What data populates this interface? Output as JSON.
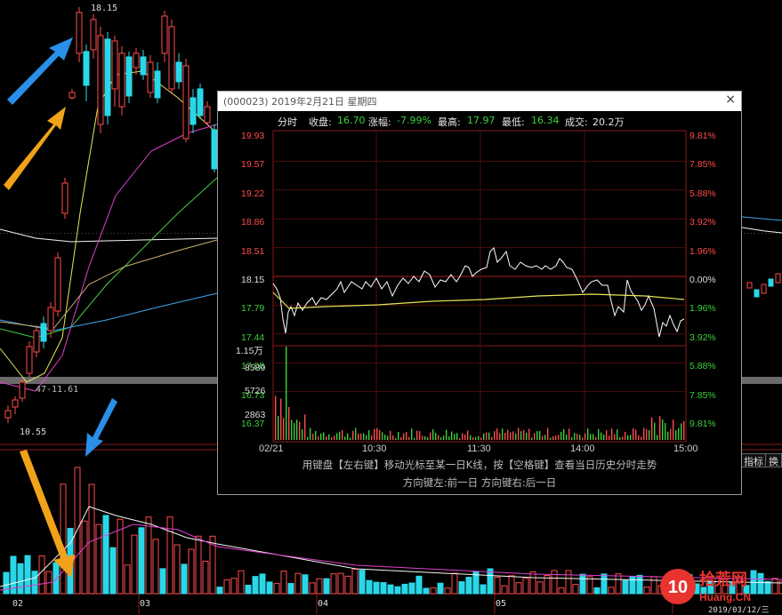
{
  "background_chart": {
    "high_label": "18.15",
    "low_label": "10.55",
    "ma_label": "47-11.61",
    "month_labels": [
      "02",
      "03",
      "04",
      "05"
    ],
    "date_tail": "2019/03/12/三",
    "side_buttons": [
      "指标",
      "换"
    ]
  },
  "popup": {
    "title": "(000023) 2019年2月21日 星期四",
    "close_glyph": "×",
    "info": {
      "label": "分时",
      "close_label": "收盘:",
      "close_value": "16.70",
      "change_label": "涨幅:",
      "change_value": "-7.99%",
      "high_label": "最高:",
      "high_value": "17.97",
      "low_label": "最低:",
      "low_value": "16.34",
      "volume_label": "成交:",
      "volume_value": "20.2万"
    },
    "price_labels": [
      "19.93",
      "19.57",
      "19.22",
      "18.86",
      "18.51",
      "18.15",
      "17.79",
      "17.44",
      "17.08",
      "16.73",
      "16.37"
    ],
    "pct_labels": [
      "9.81%",
      "7.85%",
      "5.88%",
      "3.92%",
      "1.96%",
      "0.00%",
      "1.96%",
      "3.92%",
      "5.88%",
      "7.85%",
      "9.81%"
    ],
    "volume_labels": [
      "1.15万",
      "8589",
      "5726",
      "2863"
    ],
    "time_labels": [
      "02/21",
      "10:30",
      "11:30",
      "14:00",
      "15:00"
    ],
    "hint_line1": "用键盘【左右键】移动光标至某一日K线，按【空格键】查看当日历史分时走势",
    "hint_line2": "方向键左:前一日   方向键右:后一日"
  },
  "watermark": {
    "text_main": "拾荒",
    "text_sub": "Huang.CN",
    "number": "10",
    "brand_color": "#e8332f"
  },
  "colors": {
    "up": "#ff4b4b",
    "down": "#3ad23a",
    "cyan": "#28d8e8",
    "price_line": "#ffffff",
    "avg_line": "#e6e65a",
    "arrow_blue": "#2a8fe8",
    "arrow_orange": "#f0a31a"
  }
}
